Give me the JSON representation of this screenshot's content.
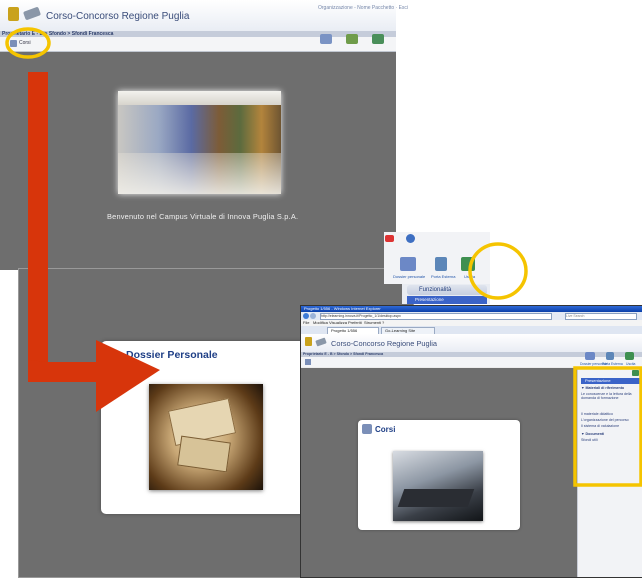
{
  "colors": {
    "gray_panel": "#6e6e6e",
    "annotation": "#f5c400",
    "arrow": "#d7350b",
    "title_blue": "#1f3f86",
    "win_blue": "#0b3fa8"
  },
  "screen1": {
    "app_title": "Corso-Concorso Regione Puglia",
    "breadcrumb": "Proprietario E - B  >  Sfondo  >  Sfondi Francesca",
    "tab_label": "Corsi",
    "welcome_text": "Benvenuto nel Campus Virtuale di Innova Puglia S.p.A.",
    "top_right_text": "Organizzazione - Nome Pacchetto · Esci"
  },
  "screen2": {
    "toolbar_labels": [
      "Dossier personale",
      "Porta Esterna",
      "Uscita"
    ],
    "menu_title": "Funzionalità",
    "menu_item": "Presentazione",
    "dossier_title": "Dossier Personale"
  },
  "screen3": {
    "window_title": "Progetto 1/556 - Windows Internet Explorer",
    "address": "http://elearning.innova.it/Progetto_1/1/desktop.aspx",
    "search_placeholder": "Live Search",
    "menu_items": [
      "File",
      "Modifica",
      "Visualizza",
      "Preferiti",
      "Strumenti",
      "?"
    ],
    "tab_label": "Progetto 1/556",
    "tab2_label": "Go-Learning Site",
    "app_title": "Corso-Concorso Regione Puglia",
    "breadcrumb": "Proprietario E - B  >  Sfondo  >  Sfondi Francesca",
    "toolbar_labels": [
      "Dossier personale",
      "Porta Esterna",
      "Uscita"
    ],
    "corsi_title": "Corsi",
    "side_header": "Presentazione",
    "side_items": [
      "▼ Materiali di riferimento",
      "Le conoscenze e la lettura della domanda di formazione",
      "Il materiale didattico",
      "L'organizzazione del percorso",
      "Il sistema di valutazione",
      "▼ Documenti",
      "Sfondi utili"
    ]
  }
}
